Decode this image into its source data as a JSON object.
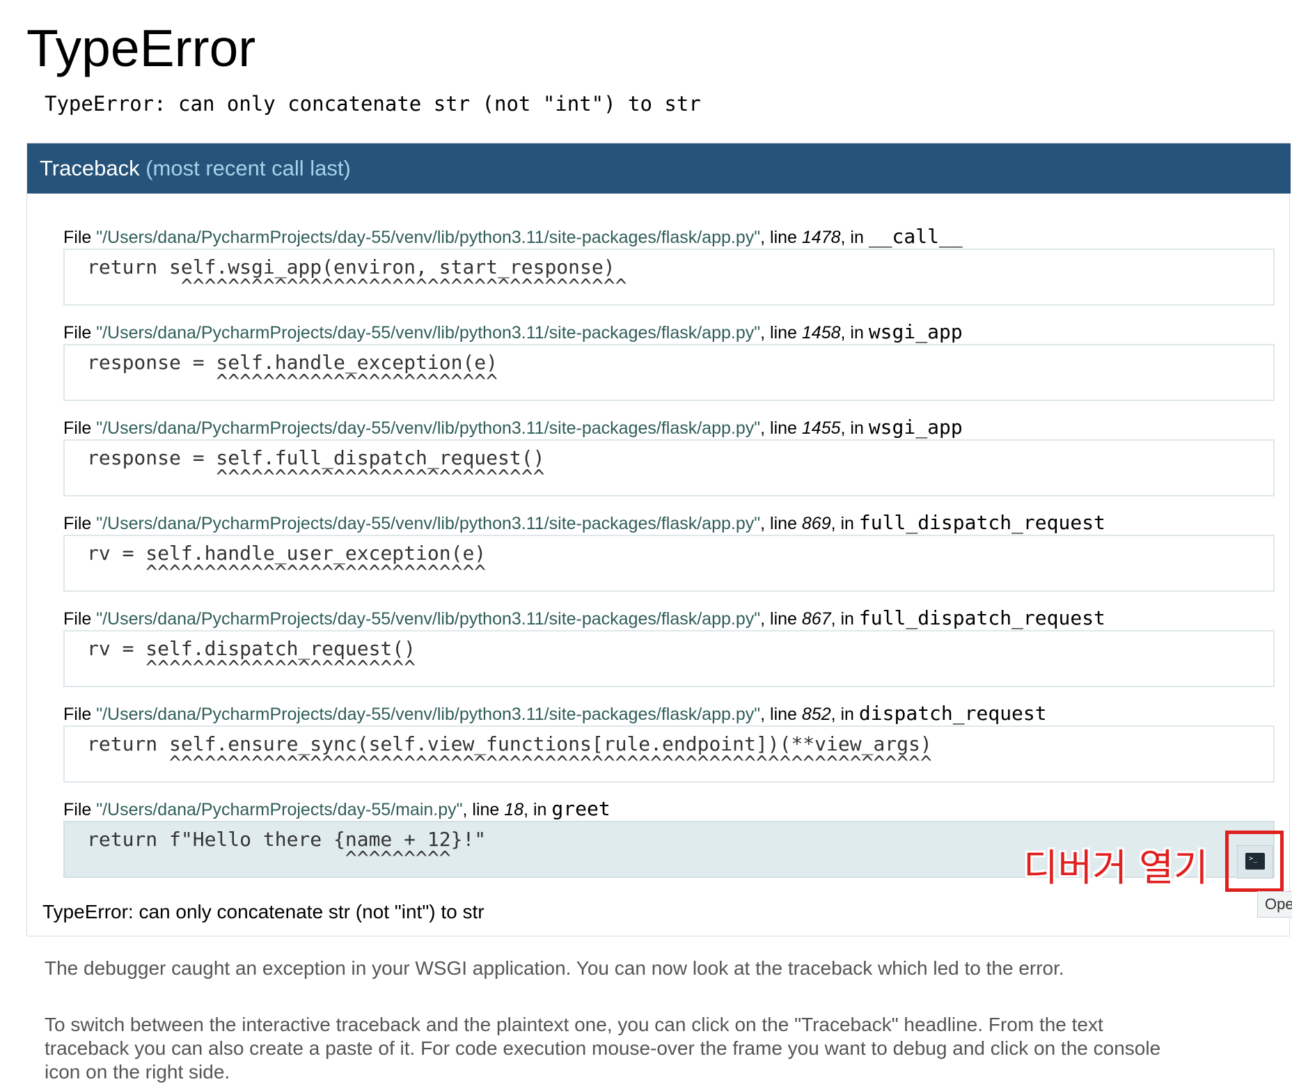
{
  "page": {
    "title": "TypeError",
    "error_message": "TypeError: can only concatenate str (not \"int\") to str"
  },
  "traceback": {
    "header": "Traceback",
    "header_sub": "(most recent call last)",
    "frames": [
      {
        "path": "\"/Users/dana/PycharmProjects/day-55/venv/lib/python3.11/site-packages/flask/app.py\"",
        "line": "1478",
        "func": "__call__",
        "code": "return self.wsgi_app(environ, start_response)",
        "marker": "        ^^^^^^^^^^^^^^^^^^^^^^^^^^^^^^^^^^^^^^"
      },
      {
        "path": "\"/Users/dana/PycharmProjects/day-55/venv/lib/python3.11/site-packages/flask/app.py\"",
        "line": "1458",
        "func": "wsgi_app",
        "code": "response = self.handle_exception(e)",
        "marker": "           ^^^^^^^^^^^^^^^^^^^^^^^^"
      },
      {
        "path": "\"/Users/dana/PycharmProjects/day-55/venv/lib/python3.11/site-packages/flask/app.py\"",
        "line": "1455",
        "func": "wsgi_app",
        "code": "response = self.full_dispatch_request()",
        "marker": "           ^^^^^^^^^^^^^^^^^^^^^^^^^^^^"
      },
      {
        "path": "\"/Users/dana/PycharmProjects/day-55/venv/lib/python3.11/site-packages/flask/app.py\"",
        "line": "869",
        "func": "full_dispatch_request",
        "code": "rv = self.handle_user_exception(e)",
        "marker": "     ^^^^^^^^^^^^^^^^^^^^^^^^^^^^^"
      },
      {
        "path": "\"/Users/dana/PycharmProjects/day-55/venv/lib/python3.11/site-packages/flask/app.py\"",
        "line": "867",
        "func": "full_dispatch_request",
        "code": "rv = self.dispatch_request()",
        "marker": "     ^^^^^^^^^^^^^^^^^^^^^^^"
      },
      {
        "path": "\"/Users/dana/PycharmProjects/day-55/venv/lib/python3.11/site-packages/flask/app.py\"",
        "line": "852",
        "func": "dispatch_request",
        "code": "return self.ensure_sync(self.view_functions[rule.endpoint])(**view_args)",
        "marker": "       ^^^^^^^^^^^^^^^^^^^^^^^^^^^^^^^^^^^^^^^^^^^^^^^^^^^^^^^^^^^^^^^^^"
      },
      {
        "path": "\"/Users/dana/PycharmProjects/day-55/main.py\"",
        "line": "18",
        "func": "greet",
        "code": "return f\"Hello there {name + 12}!\"",
        "marker": "                      ^^^^^^^^^"
      }
    ],
    "labels": {
      "file": "File ",
      "line": ", line ",
      "in": ", in "
    },
    "final_message": "TypeError: can only concatenate str (not \"int\") to str"
  },
  "annotation": {
    "text": "디버거 열기",
    "color": "#e0201f"
  },
  "console_button": {
    "icon": "terminal-icon",
    "tooltip": "Ope"
  },
  "explanation": {
    "paragraph1": "The debugger caught an exception in your WSGI application. You can now look at the traceback which led to the error.",
    "paragraph2_line1": "To switch between the interactive traceback and the plaintext one, you can click on the \"Traceback\" headline. From the text",
    "paragraph2_line2": "traceback you can also create a paste of it. For code execution mouse-over the frame you want to debug and click on the console",
    "paragraph2_line3": "icon on the right side."
  },
  "colors": {
    "header_bg": "#26537a",
    "header_sub": "#a6d2e8",
    "path": "#2f5e57",
    "current_frame_bg": "#e0ebee"
  }
}
